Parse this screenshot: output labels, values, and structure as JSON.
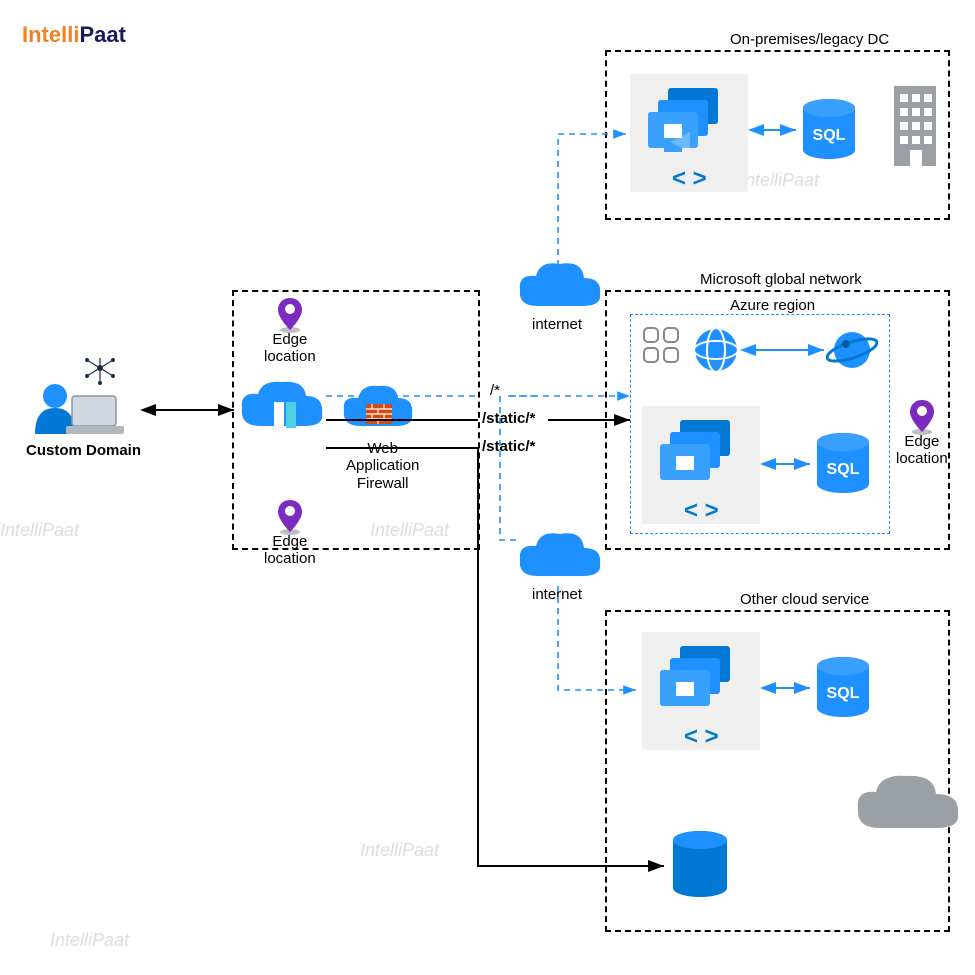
{
  "logo": {
    "part1": "Intelli",
    "part2": "Paat"
  },
  "labels": {
    "customDomain": "Custom Domain",
    "edgeLocation": "Edge\nlocation",
    "waf": "Web\nApplication\nFirewall",
    "internet": "internet",
    "onprem": "On-premises/legacy DC",
    "msGlobal": "Microsoft global network",
    "azureRegion": "Azure region",
    "otherCloud": "Other cloud service",
    "sql": "SQL",
    "pathAll": "/*",
    "pathStatic": "/static/*"
  },
  "colors": {
    "azure": "#0089d6",
    "azureDark": "#005a9e",
    "purple": "#7b2cbf",
    "grey": "#9aa0a6",
    "brick": "#d9480f"
  }
}
